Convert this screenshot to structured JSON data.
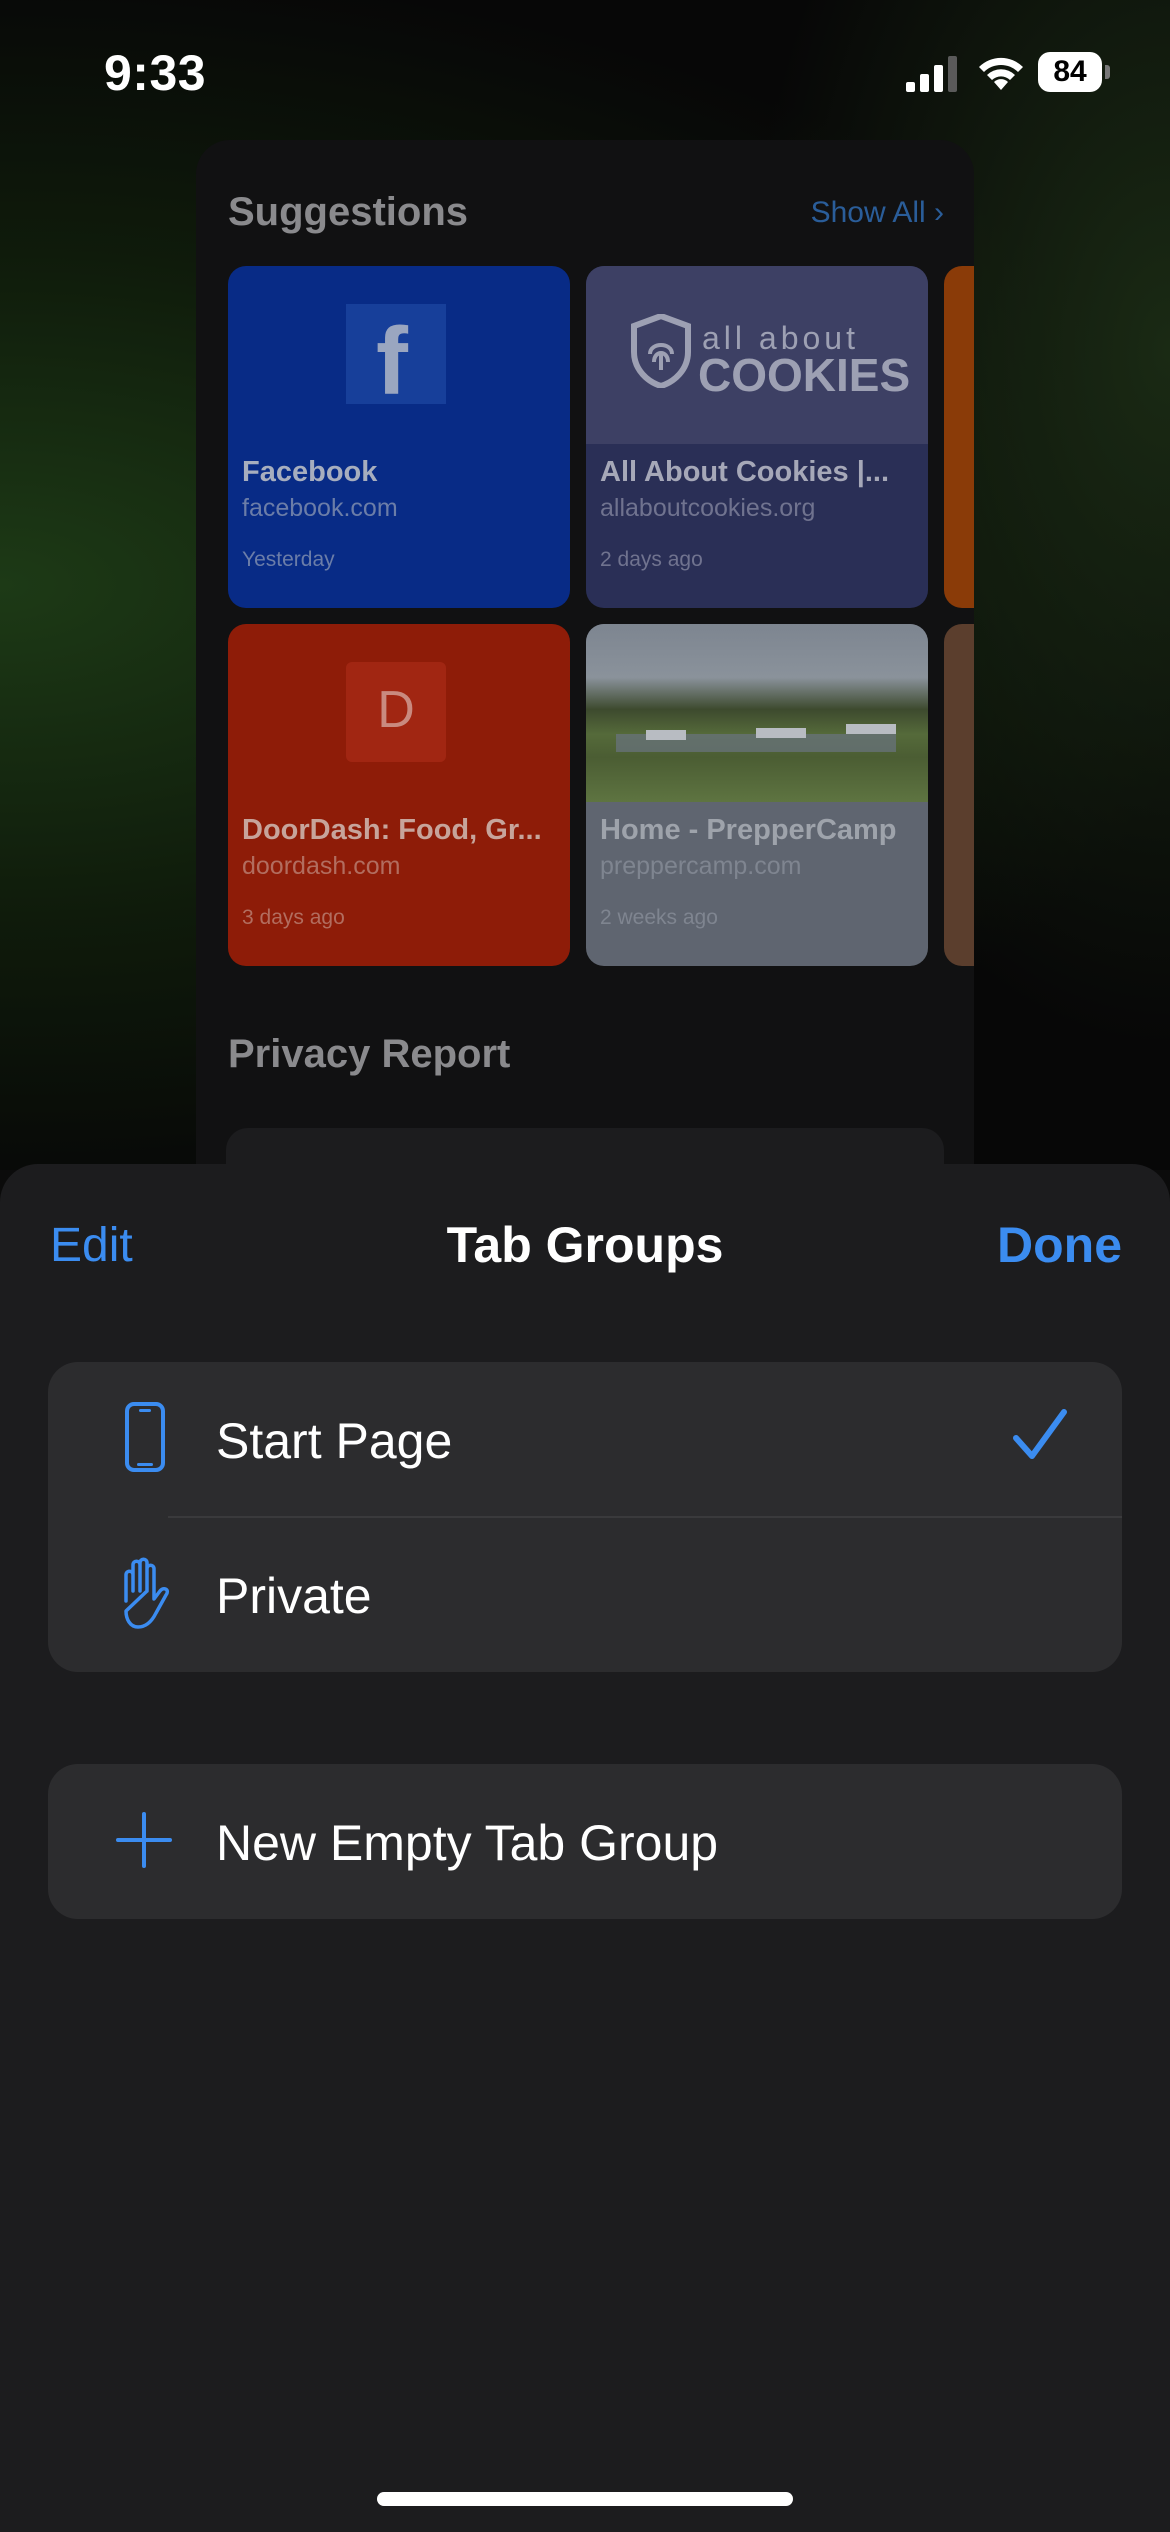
{
  "status_bar": {
    "time": "9:33",
    "battery": "84"
  },
  "start_page": {
    "suggestions_title": "Suggestions",
    "show_all": "Show All",
    "tiles": [
      {
        "name": "Facebook",
        "url": "facebook.com",
        "time": "Yesterday",
        "logo": "f"
      },
      {
        "name": "All About Cookies |...",
        "url": "allaboutcookies.org",
        "time": "2 days ago",
        "logo_line1": "all about",
        "logo_line2": "COOKIES"
      },
      {
        "name": "DoorDash: Food, Gr...",
        "url": "doordash.com",
        "time": "3 days ago",
        "logo": "D"
      },
      {
        "name": "Home - PrepperCamp",
        "url": "preppercamp.com",
        "time": "2 weeks ago"
      }
    ],
    "privacy_title": "Privacy Report"
  },
  "sheet": {
    "edit": "Edit",
    "title": "Tab Groups",
    "done": "Done",
    "groups": [
      {
        "label": "Start Page",
        "icon": "phone-icon",
        "selected": true
      },
      {
        "label": "Private",
        "icon": "hand-icon",
        "selected": false
      }
    ],
    "new_group": {
      "label": "New Empty Tab Group",
      "icon": "plus-icon"
    }
  },
  "colors": {
    "accent": "#3b8cf0",
    "sheet_bg": "#1c1c1e",
    "row_bg": "#2c2c2e"
  }
}
